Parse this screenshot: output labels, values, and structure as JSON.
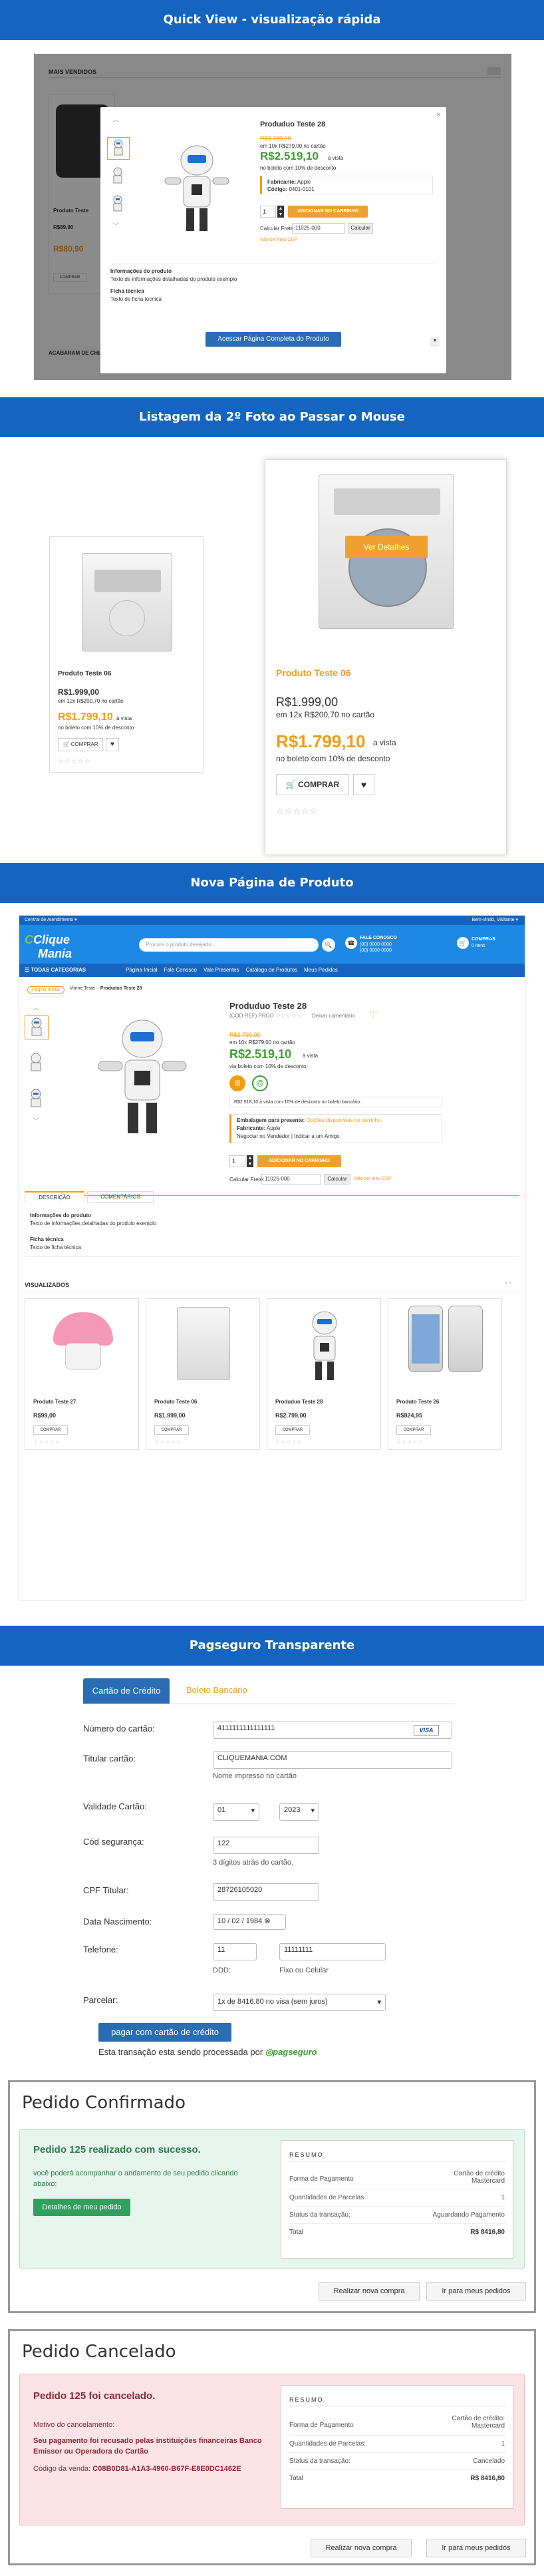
{
  "banners": {
    "b1": "Quick View - visualização rápida",
    "b2": "Listagem da 2º Foto ao Passar o Mouse",
    "b3": "Nova Página de Produto",
    "b4": "Pagseguro Transparente"
  },
  "quickview": {
    "section_title": "MAIS VENDIDOS",
    "product_name": "Produduo Teste 28",
    "old_price": "R$3.799,00",
    "installments": "em 10x R$279,00 no cartão",
    "price": "R$2.519,10",
    "price_suffix": "à vista",
    "boleto": "no boleto com 10% de desconto",
    "info_fab_label": "Fabricante:",
    "info_fab": "Apple",
    "info_code_label": "Código:",
    "info_code": "0401-0101",
    "qty": "1",
    "buy_btn": "ADICIONAR NO CARRINHO",
    "cep_label": "Calcular Frete:",
    "cep_value": "11025-000",
    "calc_btn": "Calcular",
    "cep_link": "Não sei meu CEP",
    "desc_title": "Informações do produto",
    "desc_text": "Texto de informações detalhadas do produto exemplo",
    "tech_title": "Ficha técnica",
    "tech_text": "Texto de ficha técnica",
    "full_btn": "Acessar Página Completa do Produto",
    "bg_name": "Produto Teste",
    "bg_price1": "R$89,90",
    "bg_price2": "R$80,90",
    "bg_buy": "COMPRAR",
    "bg_footer": "ACABARAM DE CHEGAR"
  },
  "listing": {
    "small": {
      "name": "Produto Teste 06",
      "price": "R$1.999,00",
      "inst": "em 12x R$200,70 no cartão",
      "cash": "R$1.799,10",
      "suffix": "à vista",
      "boleto": "no boleto com 10% de desconto",
      "buy": "COMPRAR"
    },
    "big": {
      "overlay": "Ver Detalhes",
      "name": "Produto Teste 06",
      "price": "R$1.999,00",
      "inst": "em 12x R$200,70 no cartão",
      "cash": "R$1.799,10",
      "suffix": "a vista",
      "boleto": "no boleto com 10% de desconto",
      "buy": "COMPRAR"
    }
  },
  "product_page": {
    "topbar_left": "Central de Atendimento ▾",
    "topbar_right": "Bem-vindo, Visitante ▾",
    "logo_top": "Clique",
    "logo_bottom": "Mania",
    "search_placeholder": "Procure o produto desejado...",
    "contact_title": "FALE CONOSCO",
    "contact_phone1": "(00) 0000-0000",
    "contact_phone2": "(00) 0000-0000",
    "cart_title": "COMPRAS",
    "cart_count": "0 itens",
    "categories": "TODAS CATEGORIAS",
    "nav": [
      "Página Inicial",
      "Fale Conosco",
      "Vale Presentes",
      "Catálogo de Produtos",
      "Meus Pedidos"
    ],
    "breadcrumb": [
      "Página Inicial",
      "Vitrine Teste",
      "Produduo Teste 28"
    ],
    "title": "Produduo Teste 28",
    "ref": "(COD REF) PROD",
    "fav": "Deixar comentário",
    "old_price": "R$3.799,00",
    "installments": "em 10x R$279,00 no cartão",
    "price": "R$2.519,10",
    "price_suffix": "à vista",
    "boleto": "via boleto com 10% de desconto",
    "bank_note": "R$2.518,10 à vista com 10% de desconto no boleto bancário.",
    "gift": "Embalagem para presente:",
    "gift_val": "Opções disponíveis no carrinho.",
    "fab": "Fabricante:",
    "fab_val": "Apple",
    "reg1": "Negociar no Vendedor",
    "reg2": "Indicar a um Amigo",
    "qty": "1",
    "buy": "ADICIONAR NO CARRINHO",
    "cep_label": "Calcular Frete:",
    "cep_value": "11025-000",
    "calc": "Calcular",
    "cep_link": "Não sei meu CEP",
    "tabs": [
      "DESCRIÇÃO",
      "COMENTÁRIOS"
    ],
    "desc_title": "Informações do produto",
    "desc_text": "Texto de informações detalhadas do produto exemplo",
    "tech_title": "Ficha técnica",
    "tech_text": "Texto de ficha técnica",
    "viewed_title": "VISUALIZADOS",
    "viewed": [
      {
        "name": "Produto Teste 27",
        "price": "R$99,00",
        "buy": "COMPRAR"
      },
      {
        "name": "Produto Teste 06",
        "price": "R$1.999,00",
        "buy": "COMPRAR"
      },
      {
        "name": "Produduo Teste 28",
        "price": "R$2.799,00",
        "buy": "COMPRAR"
      },
      {
        "name": "Produto Teste 26",
        "price": "R$824,95",
        "buy": "COMPRAR"
      }
    ]
  },
  "pagseguro": {
    "tab_card": "Cartão de Crédito",
    "tab_boleto": "Boleto Bancário",
    "card_number_label": "Número do cartão:",
    "card_number": "4111111111111111",
    "card_brand": "VISA",
    "holder_label": "Titular cartão:",
    "holder": "CLIQUEMANIA.COM",
    "holder_hint": "Nome impresso no cartão",
    "validity_label": "Validade Cartão:",
    "month": "01",
    "year": "2023",
    "cvv_label": "Cód segurança:",
    "cvv": "122",
    "cvv_hint": "3 dígitos atrás do cartão.",
    "cpf_label": "CPF Titular:",
    "cpf": "28726105020",
    "birth_label": "Data Nascimento:",
    "birth": "10 / 02 / 1984",
    "phone_label": "Telefone:",
    "ddd": "11",
    "phone": "11111111",
    "ddd_hint": "DDD:",
    "phone_hint": "Fixo ou Celular",
    "parcel_label": "Parcelar:",
    "parcel": "1x de 8416.80 no visa (sem juros)",
    "pay_btn": "pagar com cartão de crédito",
    "processing": "Esta transação esta sendo processada por",
    "brand": "pagseguro"
  },
  "confirmed": {
    "title": "Pedido Confirmado",
    "headline": "Pedido 125 realizado com sucesso.",
    "text": "você poderá acompanhar o andamento de seu pedido clicando abaixo:",
    "btn": "Detalhes de meu pedido",
    "summary_title": "RESUMO",
    "rows": [
      {
        "k": "Forma de Pagamento",
        "v": "Cartão de crédito Mastercard"
      },
      {
        "k": "Quantidades de Parcelas",
        "v": "1"
      },
      {
        "k": "Status da transação:",
        "v": "Aguardando Pagamento"
      },
      {
        "k": "Total",
        "v": "R$ 8416,80"
      }
    ],
    "btn_new": "Realizar nova compra",
    "btn_orders": "Ir para meus pedidos"
  },
  "canceled": {
    "title": "Pedido Cancelado",
    "headline": "Pedido 125 foi cancelado.",
    "reason_label": "Motivo do cancelamento:",
    "reason": "Seu pagamento foi recusado pelas instituições financeiras Banco Emissor ou Operadora do Cartão",
    "code_label": "Código da venda:",
    "code": "C08B0D81-A1A3-4960-B67F-E8E0DC1462E",
    "summary_title": "RESUMO",
    "rows": [
      {
        "k": "Forma de Pagamento",
        "v": "Cartão de crédito: Mastercard"
      },
      {
        "k": "Quantidades de Parcelas:",
        "v": "1"
      },
      {
        "k": "Status da transação:",
        "v": "Cancelado"
      },
      {
        "k": "Total",
        "v": "R$ 8416,80"
      }
    ],
    "btn_new": "Realizar nova compra",
    "btn_orders": "Ir para meus pedidos"
  },
  "colors": {
    "blue": "#1565c0",
    "orange": "#f39c12",
    "green": "#3a9e2e"
  }
}
